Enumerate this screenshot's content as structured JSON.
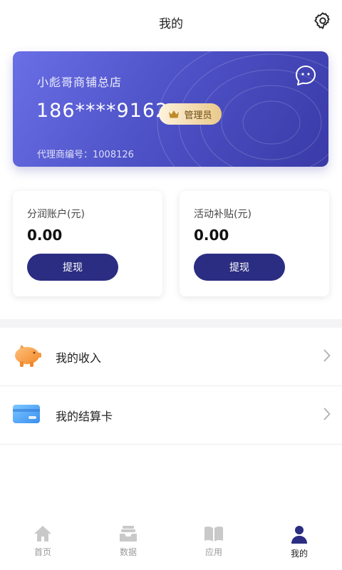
{
  "header": {
    "title": "我的",
    "settings_icon": "gear-icon"
  },
  "card": {
    "store_name": "小彪哥商铺总店",
    "phone": "186****9162",
    "badge": "管理员",
    "agent_no": "代理商编号：1008126",
    "chat_icon": "chat-bubble-icon",
    "colors": {
      "gradient_start": "#6a6fe6",
      "gradient_end": "#3a3aa8",
      "badge_gold": "#e9c98b"
    }
  },
  "accounts": [
    {
      "label": "分润账户(元)",
      "amount": "0.00",
      "button": "提现"
    },
    {
      "label": "活动补贴(元)",
      "amount": "0.00",
      "button": "提现"
    }
  ],
  "menu": [
    {
      "label": "我的收入",
      "icon": "piggy-bank-icon"
    },
    {
      "label": "我的结算卡",
      "icon": "bank-card-icon"
    }
  ],
  "tabbar": {
    "tabs": [
      {
        "label": "首页",
        "icon": "home-icon",
        "active": false
      },
      {
        "label": "数据",
        "icon": "data-tray-icon",
        "active": false
      },
      {
        "label": "应用",
        "icon": "book-icon",
        "active": false
      },
      {
        "label": "我的",
        "icon": "user-icon",
        "active": true
      }
    ],
    "active_color": "#2b2d82",
    "inactive_color": "#c9c9c9"
  },
  "accent_color": "#2b2d82"
}
